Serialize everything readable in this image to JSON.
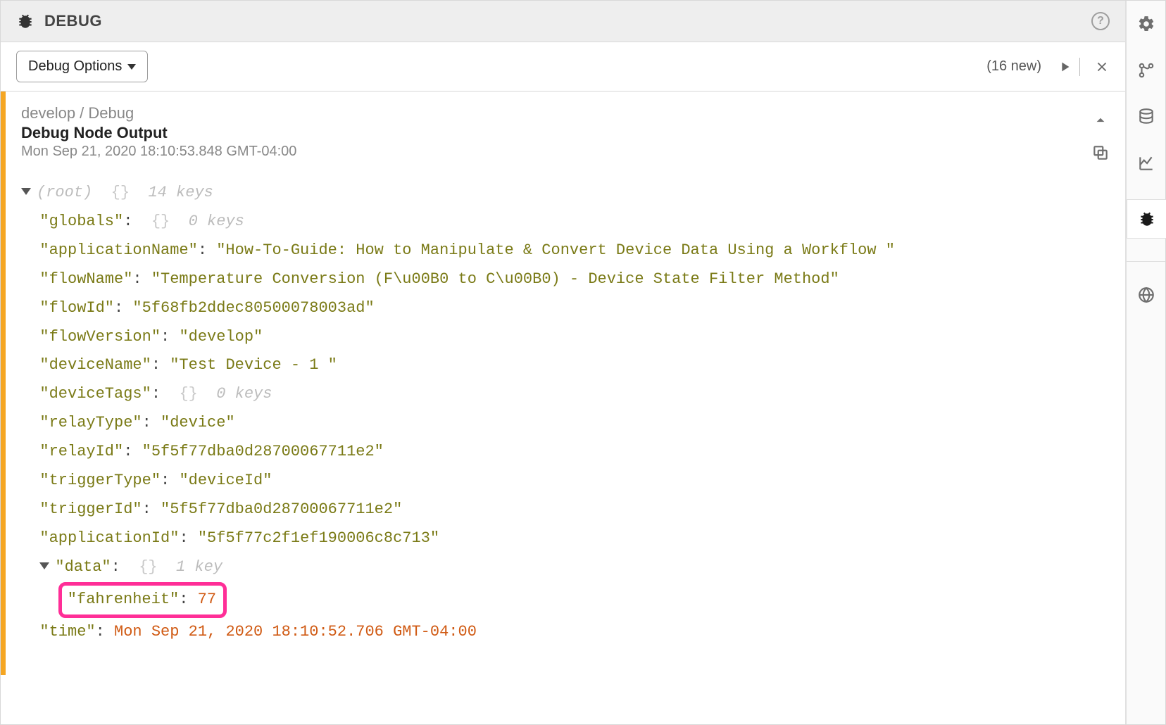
{
  "header": {
    "title": "DEBUG"
  },
  "toolbar": {
    "options_label": "Debug Options",
    "new_count": "(16 new)"
  },
  "entry": {
    "path": "develop / Debug",
    "title": "Debug Node Output",
    "timestamp": "Mon Sep 21, 2020 18:10:53.848 GMT-04:00"
  },
  "tree": {
    "root_label": "(root)",
    "root_braces": "{}",
    "root_meta": "14 keys",
    "globals_key": "\"globals\"",
    "globals_braces": "{}",
    "globals_meta": "0 keys",
    "appName_key": "\"applicationName\"",
    "appName_val": "\"How-To-Guide: How to Manipulate & Convert Device Data Using a Workflow \"",
    "flowName_key": "\"flowName\"",
    "flowName_val": "\"Temperature Conversion (F\\u00B0 to C\\u00B0) - Device State Filter Method\"",
    "flowId_key": "\"flowId\"",
    "flowId_val": "\"5f68fb2ddec80500078003ad\"",
    "flowVersion_key": "\"flowVersion\"",
    "flowVersion_val": "\"develop\"",
    "deviceName_key": "\"deviceName\"",
    "deviceName_val": "\"Test Device - 1 \"",
    "deviceTags_key": "\"deviceTags\"",
    "deviceTags_braces": "{}",
    "deviceTags_meta": "0 keys",
    "relayType_key": "\"relayType\"",
    "relayType_val": "\"device\"",
    "relayId_key": "\"relayId\"",
    "relayId_val": "\"5f5f77dba0d28700067711e2\"",
    "triggerType_key": "\"triggerType\"",
    "triggerType_val": "\"deviceId\"",
    "triggerId_key": "\"triggerId\"",
    "triggerId_val": "\"5f5f77dba0d28700067711e2\"",
    "applicationId_key": "\"applicationId\"",
    "applicationId_val": "\"5f5f77c2f1ef190006c8c713\"",
    "data_key": "\"data\"",
    "data_braces": "{}",
    "data_meta": "1 key",
    "fahrenheit_key": "\"fahrenheit\"",
    "fahrenheit_val": "77",
    "time_key": "\"time\"",
    "time_val": "Mon Sep 21, 2020 18:10:52.706 GMT-04:00"
  },
  "colon": ":"
}
